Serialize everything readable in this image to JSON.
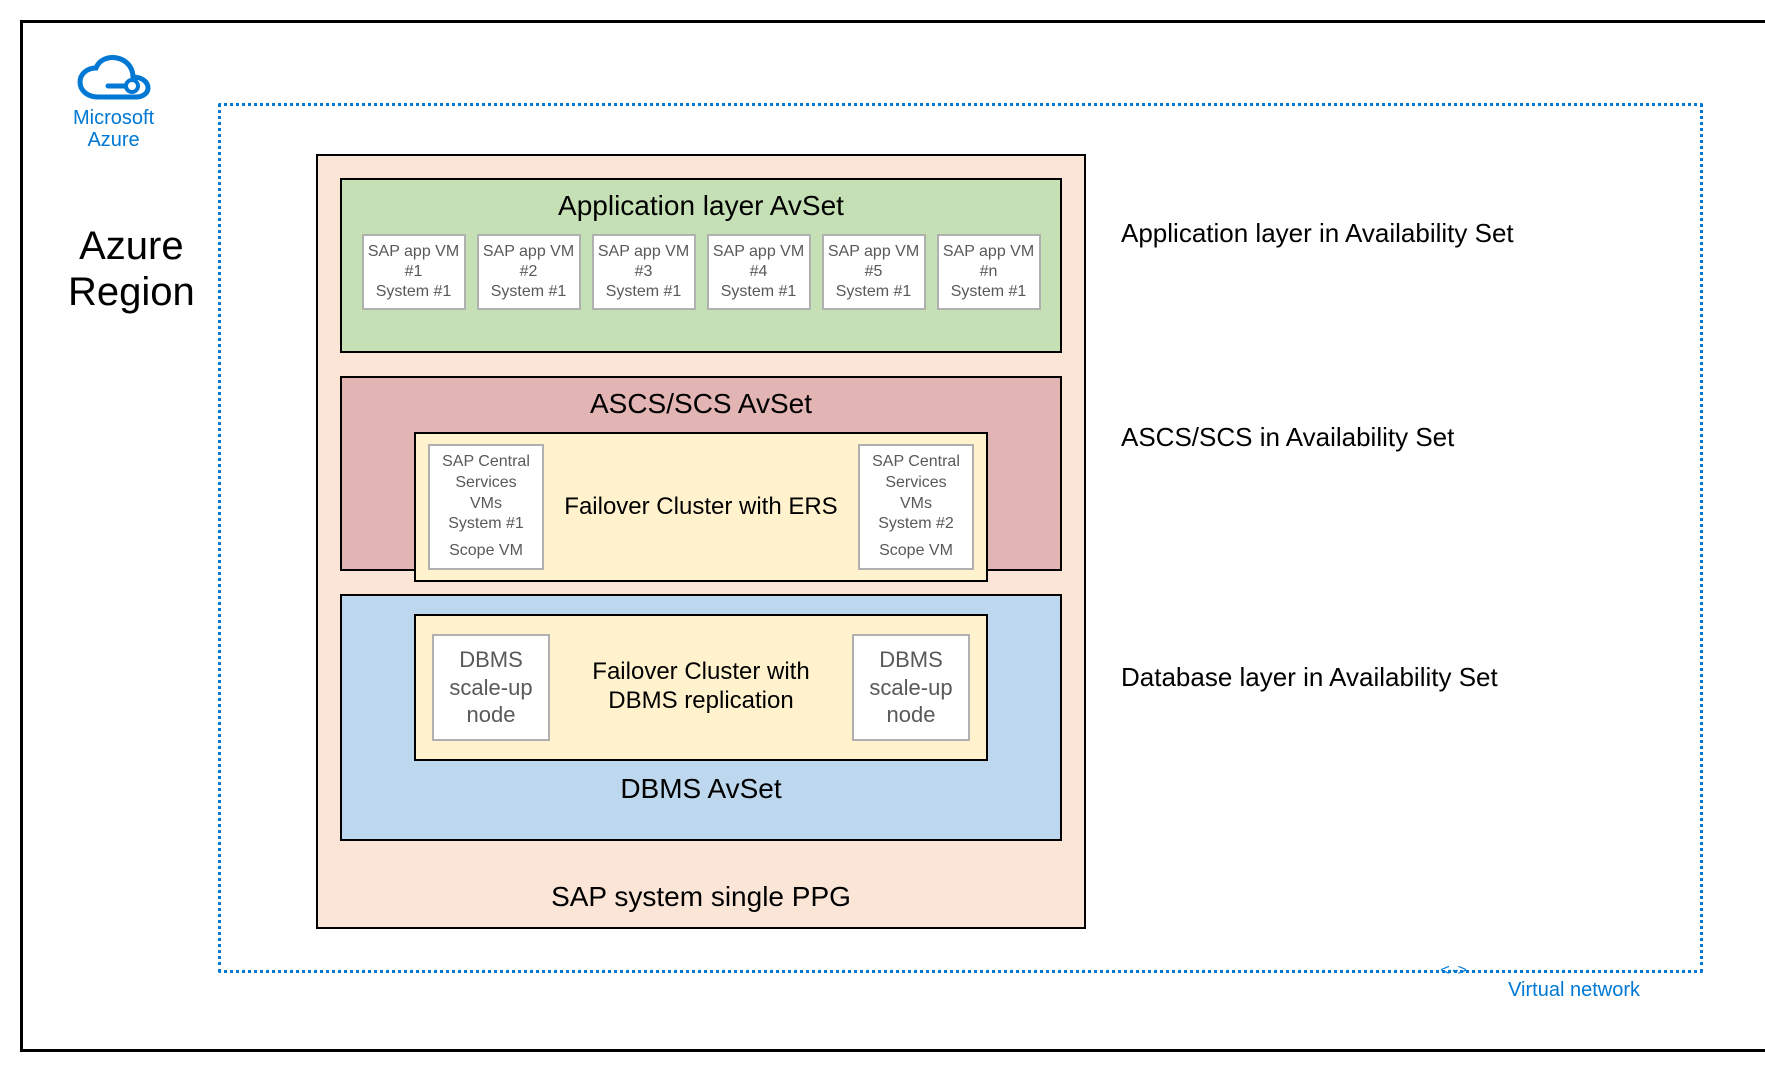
{
  "logo": {
    "line1": "Microsoft",
    "line2": "Azure"
  },
  "region_label": "Azure\nRegion",
  "vnet_label": "Virtual network",
  "ppg_title": "SAP system single PPG",
  "app_avset": {
    "title": "Application layer AvSet",
    "vms": [
      {
        "l1": "SAP app VM",
        "l2": "#1",
        "l3": "System #1"
      },
      {
        "l1": "SAP app VM",
        "l2": "#2",
        "l3": "System #1"
      },
      {
        "l1": "SAP app VM",
        "l2": "#3",
        "l3": "System #1"
      },
      {
        "l1": "SAP app VM",
        "l2": "#4",
        "l3": "System #1"
      },
      {
        "l1": "SAP app VM",
        "l2": "#5",
        "l3": "System #1"
      },
      {
        "l1": "SAP app VM",
        "l2": "#n",
        "l3": "System #1"
      }
    ]
  },
  "ascs_avset": {
    "title": "ASCS/SCS AvSet",
    "cluster_label": "Failover Cluster with ERS",
    "left": {
      "l1": "SAP Central",
      "l2": "Services VMs",
      "l3": "System #1",
      "l4": "Scope VM"
    },
    "right": {
      "l1": "SAP Central",
      "l2": "Services VMs",
      "l3": "System #2",
      "l4": "Scope VM"
    }
  },
  "dbms_avset": {
    "title": "DBMS AvSet",
    "cluster_l1": "Failover Cluster with",
    "cluster_l2": "DBMS replication",
    "left": {
      "l1": "DBMS",
      "l2": "scale-up",
      "l3": "node"
    },
    "right": {
      "l1": "DBMS",
      "l2": "scale-up",
      "l3": "node"
    }
  },
  "side_labels": {
    "app": "Application layer in Availability Set",
    "ascs": "ASCS/SCS in Availability Set",
    "dbms": "Database layer in Availability Set"
  }
}
